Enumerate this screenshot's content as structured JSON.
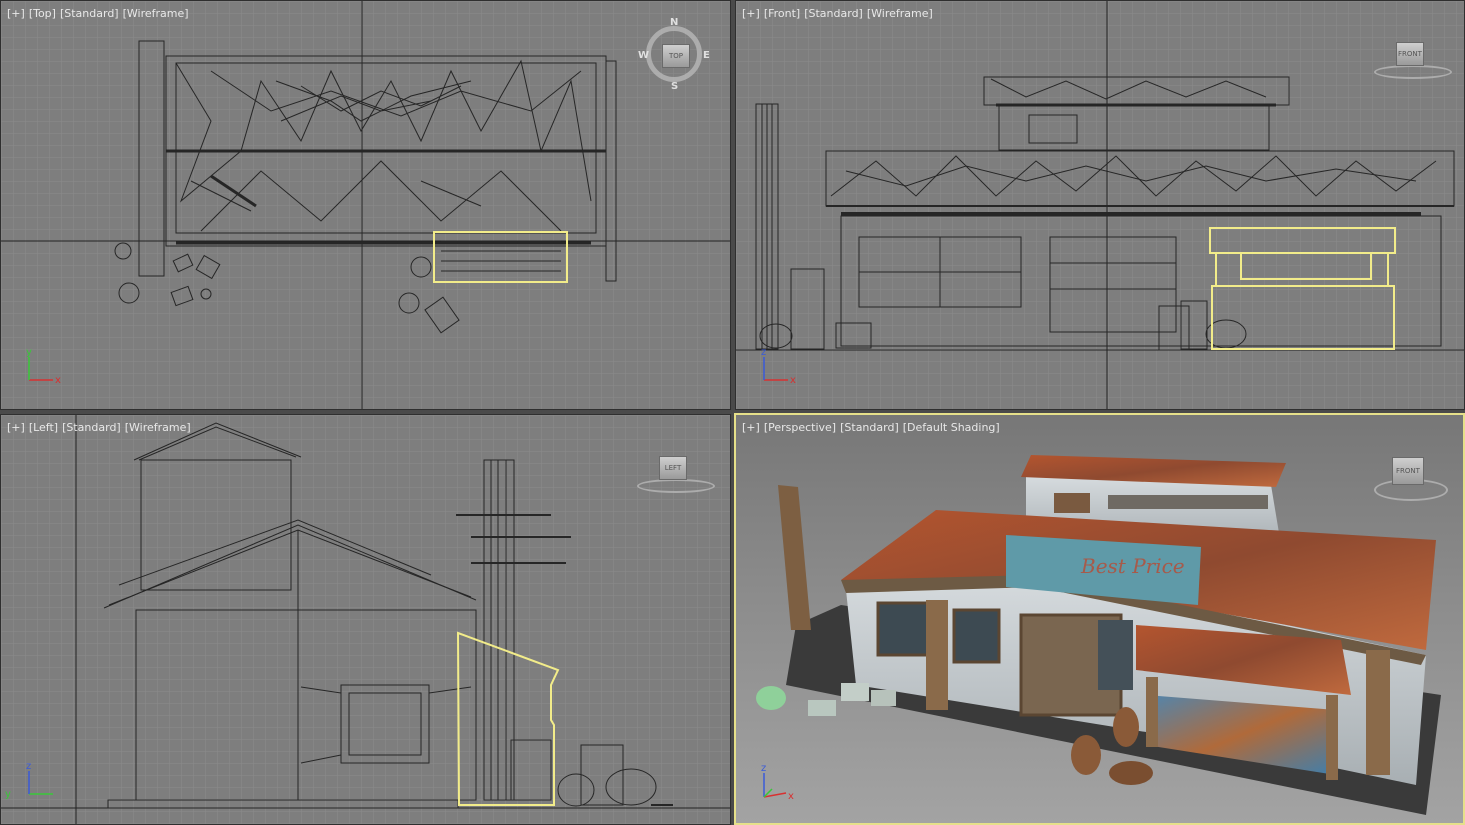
{
  "viewports": {
    "top": {
      "label": [
        "[+]",
        "[Top]",
        "[Standard]",
        "[Wireframe]"
      ],
      "cube": "TOP",
      "compass": {
        "n": "N",
        "s": "S",
        "e": "E",
        "w": "W"
      },
      "axes": {
        "h": "x",
        "v": "y"
      }
    },
    "front": {
      "label": [
        "[+]",
        "[Front]",
        "[Standard]",
        "[Wireframe]"
      ],
      "cube": "FRONT",
      "axes": {
        "h": "x",
        "v": "z"
      }
    },
    "left": {
      "label": [
        "[+]",
        "[Left]",
        "[Standard]",
        "[Wireframe]"
      ],
      "cube": "LEFT",
      "axes": {
        "h": "y",
        "v": "z"
      }
    },
    "perspective": {
      "label": [
        "[+]",
        "[Perspective]",
        "[Standard]",
        "[Default Shading]"
      ],
      "cube": "FRONT",
      "axes": {
        "h": "x",
        "v": "z"
      },
      "sign_text": "Best Price"
    }
  },
  "colors": {
    "wire": "#2a2a2a",
    "selection": "#f2ec8a",
    "grid": "#8a8a8a",
    "grid_major": "#222222",
    "axis_x": "#d83030",
    "axis_y": "#38c838",
    "axis_z": "#3a5ad8"
  }
}
